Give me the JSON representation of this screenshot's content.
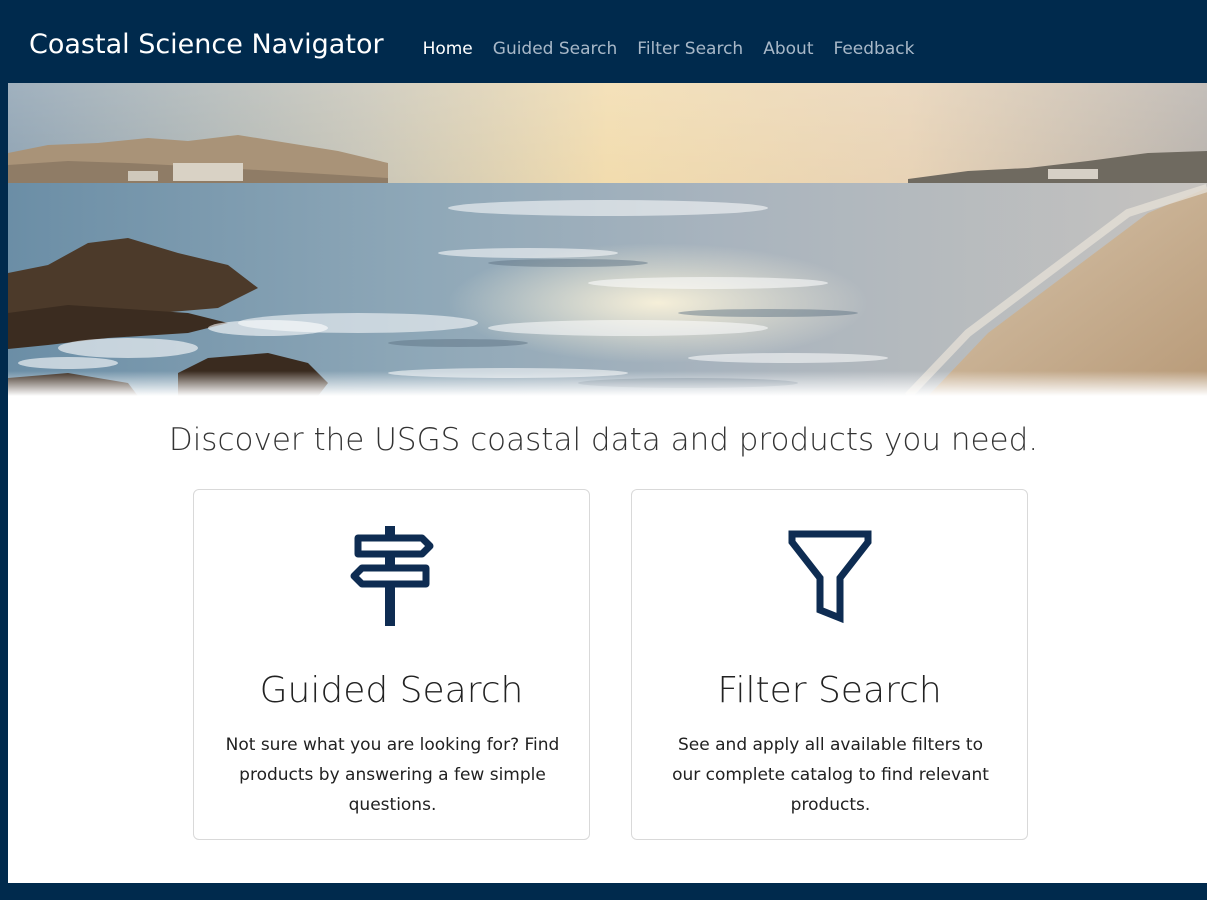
{
  "navbar": {
    "brand": "Coastal Science Navigator",
    "links": [
      {
        "label": "Home",
        "active": true
      },
      {
        "label": "Guided Search",
        "active": false
      },
      {
        "label": "Filter Search",
        "active": false
      },
      {
        "label": "About",
        "active": false
      },
      {
        "label": "Feedback",
        "active": false
      }
    ]
  },
  "main": {
    "tagline": "Discover the USGS coastal data and products you need.",
    "cards": [
      {
        "icon": "signpost-icon",
        "title": "Guided Search",
        "description": "Not sure what you are looking for? Find products by answering a few simple questions."
      },
      {
        "icon": "funnel-icon",
        "title": "Filter Search",
        "description": "See and apply all available filters to our complete catalog to find relevant products."
      }
    ]
  },
  "colors": {
    "navy": "#002a4d",
    "nav_inactive": "#a8b8c8",
    "icon": "#0e2c52"
  }
}
